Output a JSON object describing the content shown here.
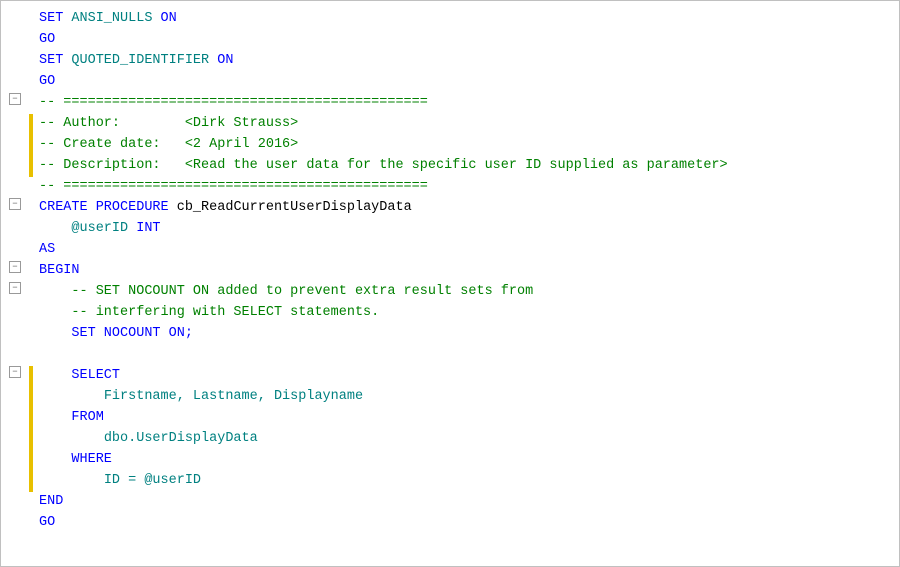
{
  "editor": {
    "lines": [
      {
        "id": 1,
        "gutter": "none",
        "yellowBar": false,
        "indent": 0,
        "tokens": [
          {
            "text": "SET ",
            "color": "blue"
          },
          {
            "text": "ANSI_NULLS",
            "color": "teal"
          },
          {
            "text": " ON",
            "color": "blue"
          }
        ]
      },
      {
        "id": 2,
        "gutter": "none",
        "yellowBar": false,
        "indent": 0,
        "tokens": [
          {
            "text": "GO",
            "color": "blue"
          }
        ]
      },
      {
        "id": 3,
        "gutter": "none",
        "yellowBar": false,
        "indent": 0,
        "tokens": [
          {
            "text": "SET ",
            "color": "blue"
          },
          {
            "text": "QUOTED_IDENTIFIER",
            "color": "teal"
          },
          {
            "text": " ON",
            "color": "blue"
          }
        ]
      },
      {
        "id": 4,
        "gutter": "none",
        "yellowBar": false,
        "indent": 0,
        "tokens": [
          {
            "text": "GO",
            "color": "blue"
          }
        ]
      },
      {
        "id": 5,
        "gutter": "collapse",
        "yellowBar": false,
        "indent": 0,
        "tokens": [
          {
            "text": "-- =============================================",
            "color": "green"
          }
        ]
      },
      {
        "id": 6,
        "gutter": "none",
        "yellowBar": true,
        "indent": 0,
        "tokens": [
          {
            "text": "-- Author:        ",
            "color": "green"
          },
          {
            "text": "<Dirk Strauss>",
            "color": "green"
          }
        ]
      },
      {
        "id": 7,
        "gutter": "none",
        "yellowBar": true,
        "indent": 0,
        "tokens": [
          {
            "text": "-- Create date:   ",
            "color": "green"
          },
          {
            "text": "<2 April 2016>",
            "color": "green"
          }
        ]
      },
      {
        "id": 8,
        "gutter": "none",
        "yellowBar": true,
        "indent": 0,
        "tokens": [
          {
            "text": "-- Description:   ",
            "color": "green"
          },
          {
            "text": "<Read the user data for the specific user ID supplied as parameter>",
            "color": "green"
          }
        ]
      },
      {
        "id": 9,
        "gutter": "none",
        "yellowBar": false,
        "indent": 0,
        "tokens": [
          {
            "text": "-- =============================================",
            "color": "green"
          }
        ]
      },
      {
        "id": 10,
        "gutter": "collapse",
        "yellowBar": false,
        "indent": 0,
        "tokens": [
          {
            "text": "CREATE PROCEDURE ",
            "color": "blue"
          },
          {
            "text": "cb_ReadCurrentUserDisplayData",
            "color": "black"
          }
        ]
      },
      {
        "id": 11,
        "gutter": "none",
        "yellowBar": false,
        "indent": 1,
        "tokens": [
          {
            "text": "@userID",
            "color": "teal"
          },
          {
            "text": " INT",
            "color": "blue"
          }
        ]
      },
      {
        "id": 12,
        "gutter": "none",
        "yellowBar": false,
        "indent": 0,
        "tokens": [
          {
            "text": "AS",
            "color": "blue"
          }
        ]
      },
      {
        "id": 13,
        "gutter": "collapse",
        "yellowBar": false,
        "indent": 0,
        "tokens": [
          {
            "text": "BEGIN",
            "color": "blue"
          }
        ]
      },
      {
        "id": 14,
        "gutter": "collapse",
        "yellowBar": false,
        "indent": 1,
        "tokens": [
          {
            "text": "-- SET NOCOUNT ON added to prevent extra result sets from",
            "color": "green"
          }
        ]
      },
      {
        "id": 15,
        "gutter": "none",
        "yellowBar": false,
        "indent": 1,
        "tokens": [
          {
            "text": "-- interfering with SELECT statements.",
            "color": "green"
          }
        ]
      },
      {
        "id": 16,
        "gutter": "none",
        "yellowBar": false,
        "indent": 1,
        "tokens": [
          {
            "text": "SET NOCOUNT ON;",
            "color": "blue"
          }
        ]
      },
      {
        "id": 17,
        "gutter": "none",
        "yellowBar": false,
        "indent": 0,
        "tokens": []
      },
      {
        "id": 18,
        "gutter": "collapse",
        "yellowBar": true,
        "indent": 1,
        "tokens": [
          {
            "text": "SELECT",
            "color": "blue"
          }
        ]
      },
      {
        "id": 19,
        "gutter": "none",
        "yellowBar": true,
        "indent": 2,
        "tokens": [
          {
            "text": "Firstname, Lastname, Displayname",
            "color": "teal"
          }
        ]
      },
      {
        "id": 20,
        "gutter": "none",
        "yellowBar": true,
        "indent": 1,
        "tokens": [
          {
            "text": "FROM",
            "color": "blue"
          }
        ]
      },
      {
        "id": 21,
        "gutter": "none",
        "yellowBar": true,
        "indent": 2,
        "tokens": [
          {
            "text": "dbo.UserDisplayData",
            "color": "teal"
          }
        ]
      },
      {
        "id": 22,
        "gutter": "none",
        "yellowBar": true,
        "indent": 1,
        "tokens": [
          {
            "text": "WHERE",
            "color": "blue"
          }
        ]
      },
      {
        "id": 23,
        "gutter": "none",
        "yellowBar": true,
        "indent": 2,
        "tokens": [
          {
            "text": "ID = @userID",
            "color": "teal"
          }
        ]
      },
      {
        "id": 24,
        "gutter": "none",
        "yellowBar": false,
        "indent": 0,
        "tokens": [
          {
            "text": "END",
            "color": "blue"
          }
        ]
      },
      {
        "id": 25,
        "gutter": "none",
        "yellowBar": false,
        "indent": 0,
        "tokens": [
          {
            "text": "GO",
            "color": "blue"
          }
        ]
      }
    ]
  }
}
